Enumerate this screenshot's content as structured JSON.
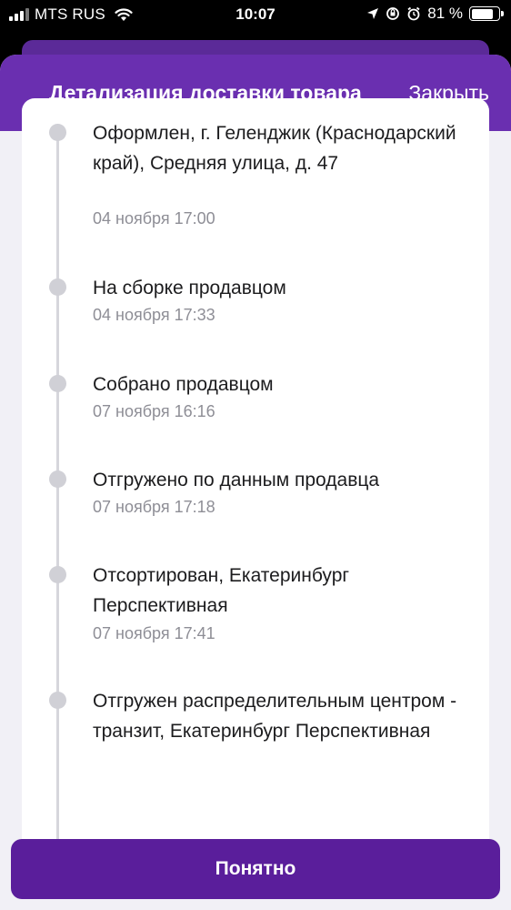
{
  "status_bar": {
    "carrier": "MTS RUS",
    "time": "10:07",
    "battery_percent": "81 %",
    "battery_level": 0.81
  },
  "header": {
    "title": "Детализация доставки товара",
    "close_label": "Закрыть"
  },
  "events": [
    {
      "title": "Оформлен, г. Геленджик (Краснодарский край), Средняя улица, д. 47",
      "time": "04 ноября 17:00"
    },
    {
      "title": "На сборке продавцом",
      "time": "04 ноября 17:33"
    },
    {
      "title": "Собрано продавцом",
      "time": "07 ноября 16:16"
    },
    {
      "title": "Отгружено по данным продавца",
      "time": "07 ноября 17:18"
    },
    {
      "title": "Отсортирован, Екатеринбург Перспективная",
      "time": "07 ноября 17:41"
    },
    {
      "title": "Отгружен распределительным центром - транзит, Екатеринбург Перспективная",
      "time": ""
    }
  ],
  "footer": {
    "ok_label": "Понятно"
  },
  "colors": {
    "header_purple": "#6a2fb0",
    "button_purple": "#5a1e9b",
    "sheet_bg": "#f1f0f6"
  }
}
